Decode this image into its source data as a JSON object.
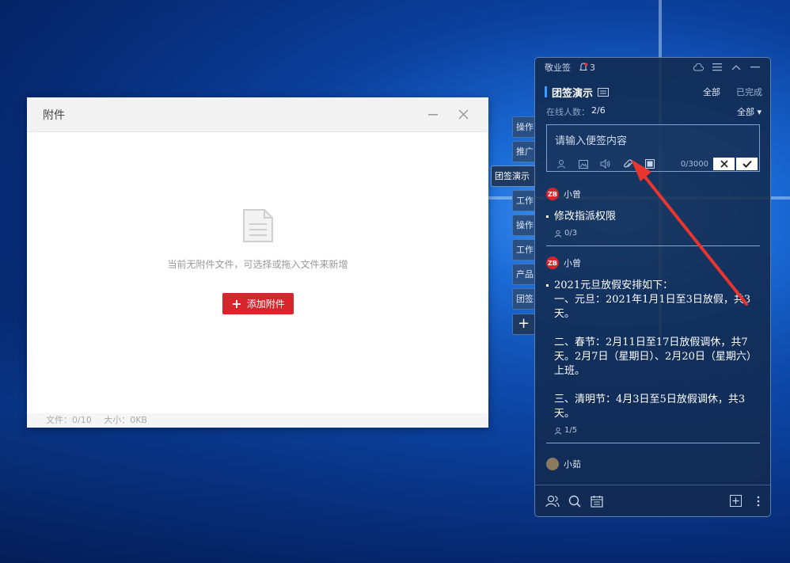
{
  "dialog": {
    "title": "附件",
    "empty_message": "当前无附件文件，可选择或拖入文件来新增",
    "add_button": "添加附件",
    "footer_files": "文件：0/10",
    "footer_size": "大小：0KB"
  },
  "side_tabs": [
    "操作",
    "推广",
    "团签演示",
    "工作",
    "操作",
    "工作",
    "产品",
    "团签"
  ],
  "side_add_label": "+",
  "panel": {
    "app_name": "敬业签",
    "notification_count": "3",
    "group_title": "团签演示",
    "filter_all": "全部",
    "filter_done": "已完成",
    "online_label": "在线人数：",
    "online_value": "2/6",
    "sort_label": "全部 ▾",
    "input_placeholder": "请输入便签内容",
    "char_count": "0/3000",
    "notes": [
      {
        "author": "小曾",
        "avatar_text": "ZB",
        "content": "修改指派权限",
        "assign": "0/3"
      },
      {
        "author": "小曾",
        "avatar_text": "ZB",
        "content": "2021元旦放假安排如下：\n一、元旦：2021年1月1日至3日放假，共3天。\n\n二、春节：2月11日至17日放假调休，共7天。2月7日（星期日）、2月20日（星期六）上班。\n\n三、清明节：4月3日至5日放假调休，共3天。",
        "assign": "1/5"
      },
      {
        "author": "小茹",
        "avatar_text": ""
      }
    ]
  },
  "colors": {
    "accent_red": "#d6262c",
    "panel_bg": "#122a4e",
    "highlight_blue": "#3b9cff"
  }
}
